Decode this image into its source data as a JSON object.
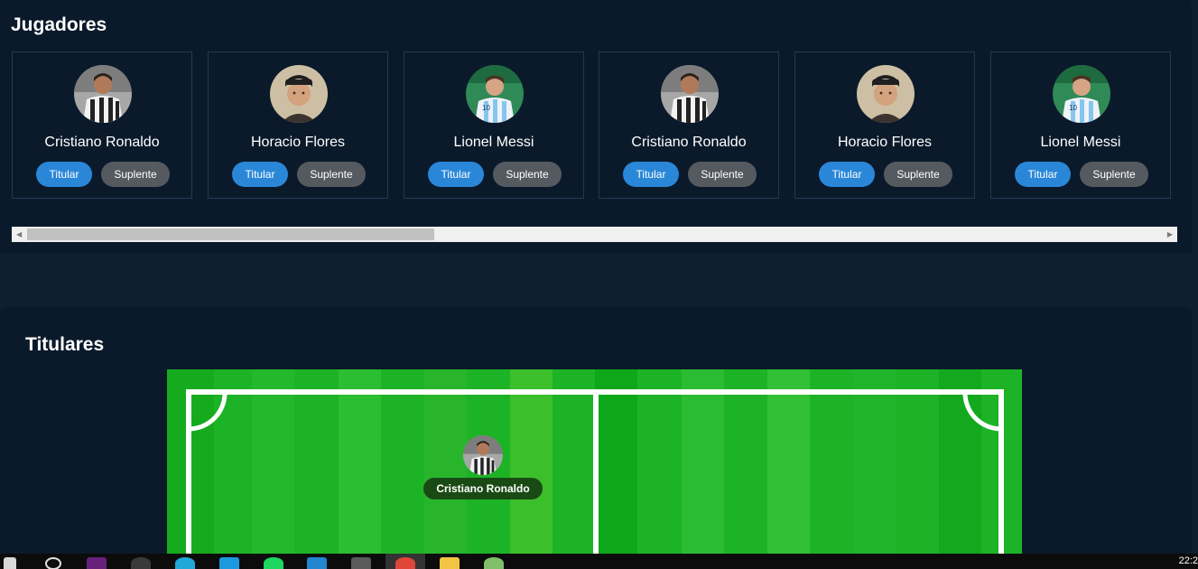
{
  "jugadores": {
    "title": "Jugadores",
    "players": [
      {
        "name": "Cristiano Ronaldo",
        "titular_label": "Titular",
        "suplente_label": "Suplente",
        "avatar": "ronaldo"
      },
      {
        "name": "Horacio Flores",
        "titular_label": "Titular",
        "suplente_label": "Suplente",
        "avatar": "horacio"
      },
      {
        "name": "Lionel Messi",
        "titular_label": "Titular",
        "suplente_label": "Suplente",
        "avatar": "messi"
      },
      {
        "name": "Cristiano Ronaldo",
        "titular_label": "Titular",
        "suplente_label": "Suplente",
        "avatar": "ronaldo"
      },
      {
        "name": "Horacio Flores",
        "titular_label": "Titular",
        "suplente_label": "Suplente",
        "avatar": "horacio"
      },
      {
        "name": "Lionel Messi",
        "titular_label": "Titular",
        "suplente_label": "Suplente",
        "avatar": "messi"
      }
    ]
  },
  "titulares": {
    "title": "Titulares",
    "pitch_players": [
      {
        "name": "Cristiano Ronaldo",
        "avatar": "ronaldo"
      }
    ]
  },
  "colors": {
    "titular_button": "#2a87d8",
    "suplente_button": "#555a60",
    "pitch_green": "#1db326"
  },
  "taskbar": {
    "clock": "22:2",
    "icons": [
      "windows-start-icon",
      "search-icon",
      "visual-studio-icon",
      "obs-icon",
      "edge-icon",
      "prime-video-icon",
      "spotify-icon",
      "vscode-icon",
      "terminal-icon",
      "chrome-icon",
      "file-explorer-icon",
      "paint-icon"
    ]
  }
}
